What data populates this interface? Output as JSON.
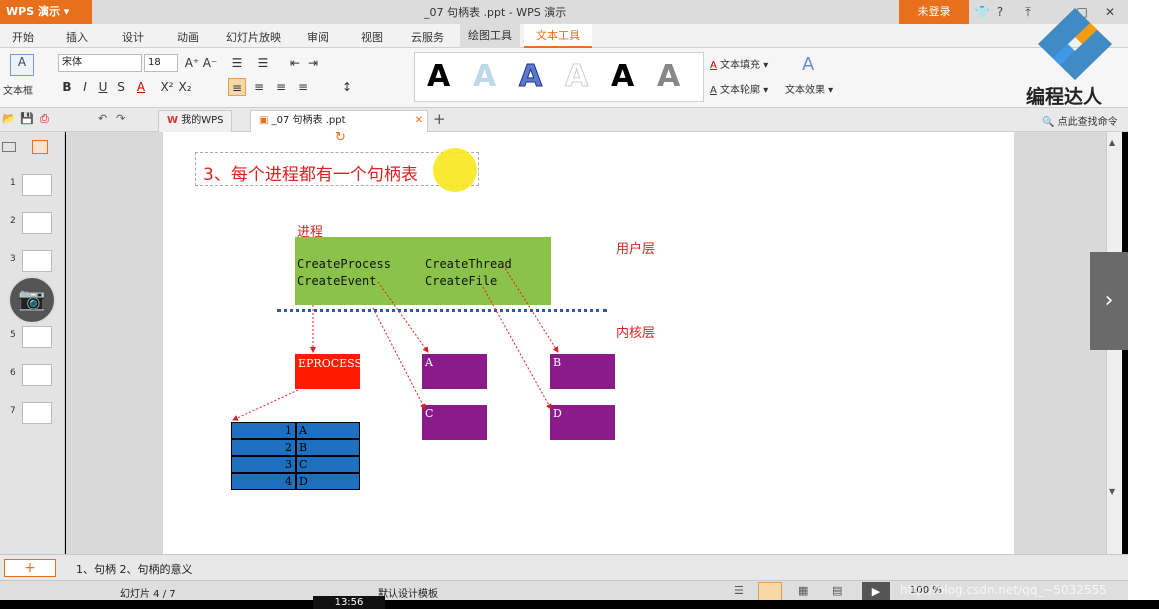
{
  "titlebar": {
    "app_name": "WPS 演示",
    "doc_title": "_07  句柄表 .ppt - WPS 演示",
    "login_label": "未登录",
    "help_label": "?"
  },
  "menu": [
    "开始",
    "插入",
    "设计",
    "动画",
    "幻灯片放映",
    "审阅",
    "视图",
    "云服务",
    "绘图工具",
    "文本工具"
  ],
  "active_menu": "文本工具",
  "ribbon": {
    "textbox_label": "文本框",
    "font_name": "宋体",
    "font_size": "18",
    "text_fill": "文本填充",
    "text_outline": "文本轮廓",
    "text_effect": "文本效果"
  },
  "tabs": {
    "mywps": "我的WPS",
    "doc": "_07  句柄表 .ppt",
    "search": "点此查找命令"
  },
  "logo_text": "编程达人",
  "thumbnails": [
    "1",
    "2",
    "3",
    "4",
    "5",
    "6",
    "7"
  ],
  "slide": {
    "title": "3、每个进程都有一个句柄表",
    "process_label": "进程",
    "user_layer": "用户层",
    "kernel_layer": "内核层",
    "api_1": "CreateProcess",
    "api_2": "CreateThread",
    "api_3": "CreateEvent",
    "api_4": "CreateFile",
    "eprocess": "EPROCESS",
    "obj_a": "A",
    "obj_b": "B",
    "obj_c": "C",
    "obj_d": "D",
    "table_rows": [
      {
        "num": "1",
        "val": "A"
      },
      {
        "num": "2",
        "val": "B"
      },
      {
        "num": "3",
        "val": "C"
      },
      {
        "num": "4",
        "val": "D"
      }
    ]
  },
  "notes": "1、句柄   2、句柄的意义",
  "status": {
    "slide_pos": "幻灯片 4 / 7",
    "template": "默认设计模板",
    "zoom": "100 %"
  },
  "overlay": {
    "time": "13:56",
    "watermark": "http://blog.csdn.net/qq_~5032555"
  }
}
